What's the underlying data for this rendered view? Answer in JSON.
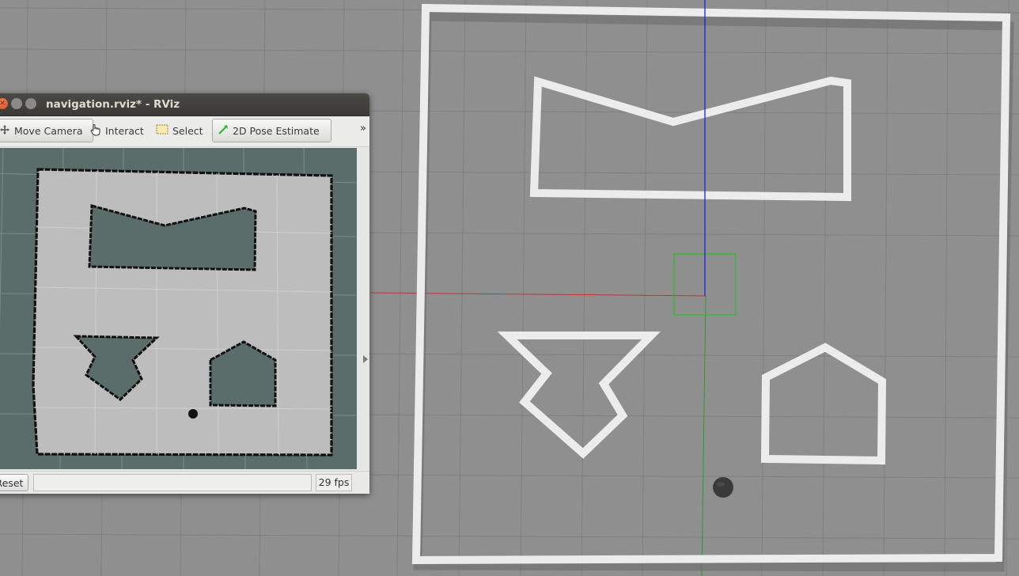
{
  "window": {
    "title": "navigation.rviz* - RViz",
    "controls": {
      "close_glyph": "✕"
    }
  },
  "toolbar": {
    "tools": [
      {
        "label": "Move Camera",
        "icon": "move-camera-icon",
        "active": true
      },
      {
        "label": "Interact",
        "icon": "hand-pointer-icon",
        "active": false
      },
      {
        "label": "Select",
        "icon": "select-rectangle-icon",
        "active": false
      },
      {
        "label": "2D Pose Estimate",
        "icon": "pose-arrow-icon",
        "active": false
      }
    ],
    "overflow_glyph": "»"
  },
  "statusbar": {
    "reset_label": "Reset",
    "fps_label": "29 fps"
  },
  "colors": {
    "gazebo_ground": "#8f8f8f",
    "gazebo_walls": "#ececec",
    "map_free": "#bdbdbd",
    "map_unknown": "#5b6d6a",
    "map_occupied": "#111111",
    "axis_x": "#b33a3a",
    "axis_y": "#2e9a2e",
    "axis_z": "#2020e0",
    "robot_footprint": "#2fb82f",
    "robot": "#3a3a3a"
  }
}
